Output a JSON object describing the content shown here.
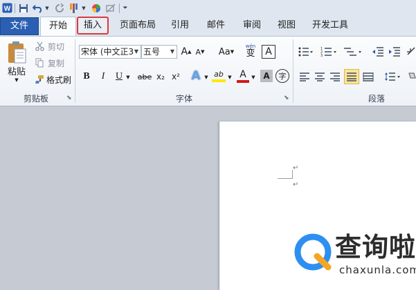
{
  "quick_access": {
    "app_icon": "word-icon",
    "items": [
      "save-icon",
      "undo-icon",
      "redo-icon",
      "format-painter-icon",
      "color-wheel-icon",
      "no-edit-icon",
      "customize-icon"
    ]
  },
  "tabs": {
    "file": "文件",
    "home": "开始",
    "insert": "插入",
    "page_layout": "页面布局",
    "references": "引用",
    "mailings": "邮件",
    "review": "审阅",
    "view": "视图",
    "developer": "开发工具"
  },
  "clipboard": {
    "paste_label": "粘贴",
    "cut_label": "剪切",
    "copy_label": "复制",
    "format_painter_label": "格式刷",
    "group_label": "剪贴板"
  },
  "font": {
    "font_name": "宋体 (中文正3",
    "font_size": "五号",
    "grow": "A",
    "shrink": "A",
    "change_case": "Aa",
    "phonetic_top": "wén",
    "phonetic_char": "变",
    "border_char": "A",
    "bold": "B",
    "italic": "I",
    "underline": "U",
    "strike": "abe",
    "subscript": "x₂",
    "superscript": "x²",
    "text_effect": "A",
    "highlight": "ab",
    "font_color": "A",
    "char_shading": "A",
    "enclose_char": "字",
    "group_label": "字体"
  },
  "paragraph": {
    "group_label": "段落"
  },
  "watermark": {
    "name": "查询啦",
    "url": "chaxunla.com"
  },
  "colors": {
    "file_tab": "#2b5fb3",
    "highlight_box": "#d9393d",
    "accent_blue": "#2e8ff0",
    "accent_orange": "#f5a623",
    "font_red": "#d01919",
    "highlight_yellow": "#ffe600"
  }
}
